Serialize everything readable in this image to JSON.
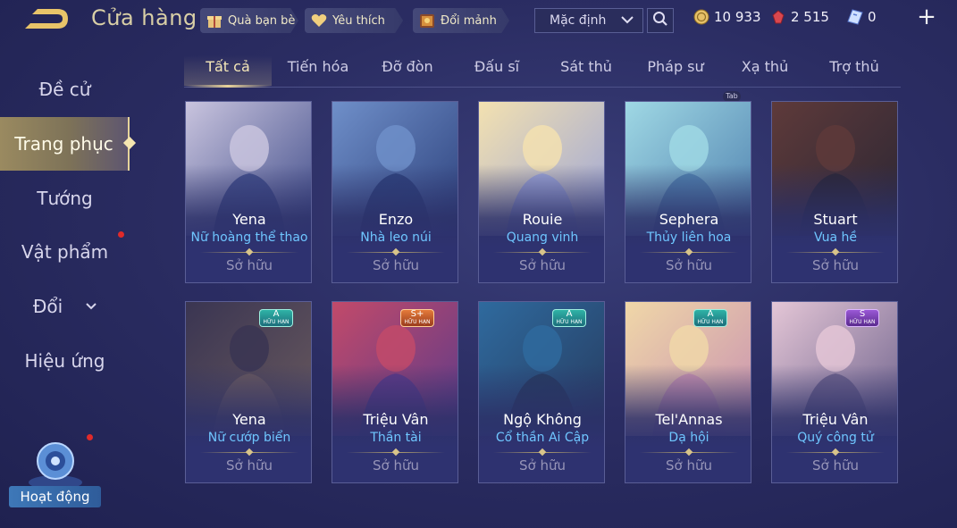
{
  "header": {
    "title": "Cửa hàng",
    "gift_friend": "Quà bạn bè",
    "favorite": "Yêu thích",
    "exchange_fragments": "Đổi mảnh",
    "sort_value": "Mặc định"
  },
  "currencies": {
    "gold": "10 933",
    "gems": "2 515",
    "vouchers": "0"
  },
  "sidebar": {
    "items": [
      {
        "label": "Đề cử"
      },
      {
        "label": "Trang phục"
      },
      {
        "label": "Tướng"
      },
      {
        "label": "Vật phẩm"
      },
      {
        "label": "Đổi"
      },
      {
        "label": "Hiệu ứng"
      }
    ],
    "event_label": "Hoạt động"
  },
  "tabs": [
    "Tất cả",
    "Tiến hóa",
    "Đỡ đòn",
    "Đấu sĩ",
    "Sát thủ",
    "Pháp sư",
    "Xạ thủ",
    "Trợ thủ"
  ],
  "tab_hint": "Tab",
  "cards": [
    {
      "hero": "Yena",
      "skin": "Nữ hoàng thể thao",
      "status": "Sở hữu",
      "colors": [
        "#c9c4de",
        "#3d4a88"
      ]
    },
    {
      "hero": "Enzo",
      "skin": "Nhà leo núi",
      "status": "Sở hữu",
      "colors": [
        "#6f8fc9",
        "#2b3f7a"
      ]
    },
    {
      "hero": "Rouie",
      "skin": "Quang vinh",
      "status": "Sở hữu",
      "colors": [
        "#f3e1b0",
        "#9aa3d8"
      ]
    },
    {
      "hero": "Sephera",
      "skin": "Thủy liên hoa",
      "status": "Sở hữu",
      "colors": [
        "#9fd8e4",
        "#4e7fae"
      ]
    },
    {
      "hero": "Stuart",
      "skin": "Vua hề",
      "status": "Sở hữu",
      "colors": [
        "#5e3a3a",
        "#2a2634"
      ]
    },
    {
      "hero": "Yena",
      "skin": "Nữ cướp biển",
      "status": "Sở hữu",
      "badge": {
        "tier": "A",
        "text": "HỮU HẠN"
      },
      "colors": [
        "#3a3552",
        "#6a5a5e"
      ]
    },
    {
      "hero": "Triệu Vân",
      "skin": "Thần tài",
      "status": "Sở hữu",
      "badge": {
        "tier": "S+",
        "text": "HỮU HẠN"
      },
      "colors": [
        "#c24a6a",
        "#5a3a8a"
      ]
    },
    {
      "hero": "Ngộ Không",
      "skin": "Cổ thần Ai Cập",
      "status": "Sở hữu",
      "badge": {
        "tier": "A",
        "text": "HỮU HẠN"
      },
      "colors": [
        "#2f6a9e",
        "#263a5e"
      ]
    },
    {
      "hero": "Tel'Annas",
      "skin": "Dạ hội",
      "status": "Sở hữu",
      "badge": {
        "tier": "A",
        "text": "HỮU HẠN"
      },
      "colors": [
        "#f0d7a8",
        "#c78fb0"
      ]
    },
    {
      "hero": "Triệu Vân",
      "skin": "Quý công tử",
      "status": "Sở hữu",
      "badge": {
        "tier": "S",
        "text": "HỮU HẠN"
      },
      "colors": [
        "#e4c6d6",
        "#6a5f8a"
      ]
    }
  ],
  "colors": {
    "accent_gold": "#e9d49a",
    "skin_name_blue": "#6fc6ff"
  }
}
